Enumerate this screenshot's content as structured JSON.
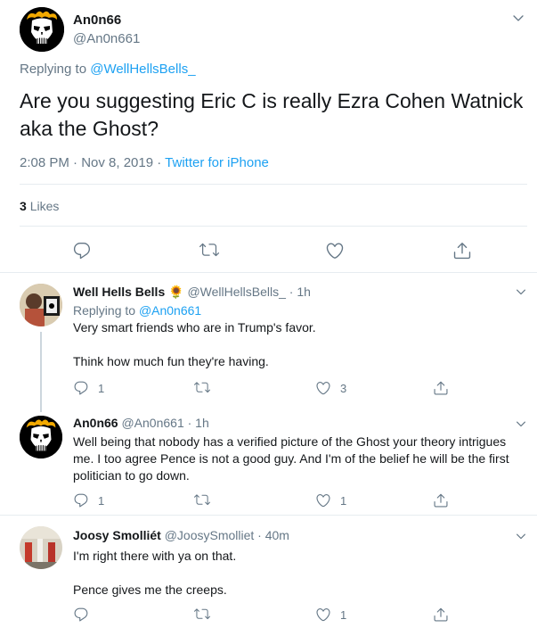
{
  "main_tweet": {
    "name": "An0n66",
    "handle": "@An0n661",
    "replying_prefix": "Replying to",
    "replying_to": "@WellHellsBells_",
    "text": "Are you suggesting Eric C is really Ezra Cohen Watnick aka the Ghost?",
    "time": "2:08 PM · Nov 8, 2019 ·",
    "source": "Twitter for iPhone",
    "likes_count": "3",
    "likes_label": "Likes"
  },
  "replies": [
    {
      "name": "Well Hells Bells",
      "emoji": "🌻",
      "handle": "@WellHellsBells_ · 1h",
      "replying_prefix": "Replying to",
      "replying_to": "@An0n661",
      "text": "Very smart friends who are in Trump's favor.\n\nThink how much fun they're having.",
      "reply_count": "1",
      "retweet_count": "",
      "like_count": "3"
    },
    {
      "name": "An0n66",
      "handle": "@An0n661 · 1h",
      "text": "Well being that nobody has a verified picture of the Ghost your theory intrigues me. I too agree Pence is not a good guy. And I'm of the belief he will be the first politician to go down.",
      "reply_count": "1",
      "retweet_count": "",
      "like_count": "1"
    },
    {
      "name": "Joosy Smolliét",
      "handle": "@JoosySmolliet · 40m",
      "text": "I'm right there with ya on that.\n\nPence gives me the creeps.",
      "reply_count": "",
      "retweet_count": "",
      "like_count": "1"
    }
  ],
  "colors": {
    "link": "#1da1f2",
    "muted": "#657786",
    "text": "#14171a",
    "border": "#e6ecf0"
  }
}
